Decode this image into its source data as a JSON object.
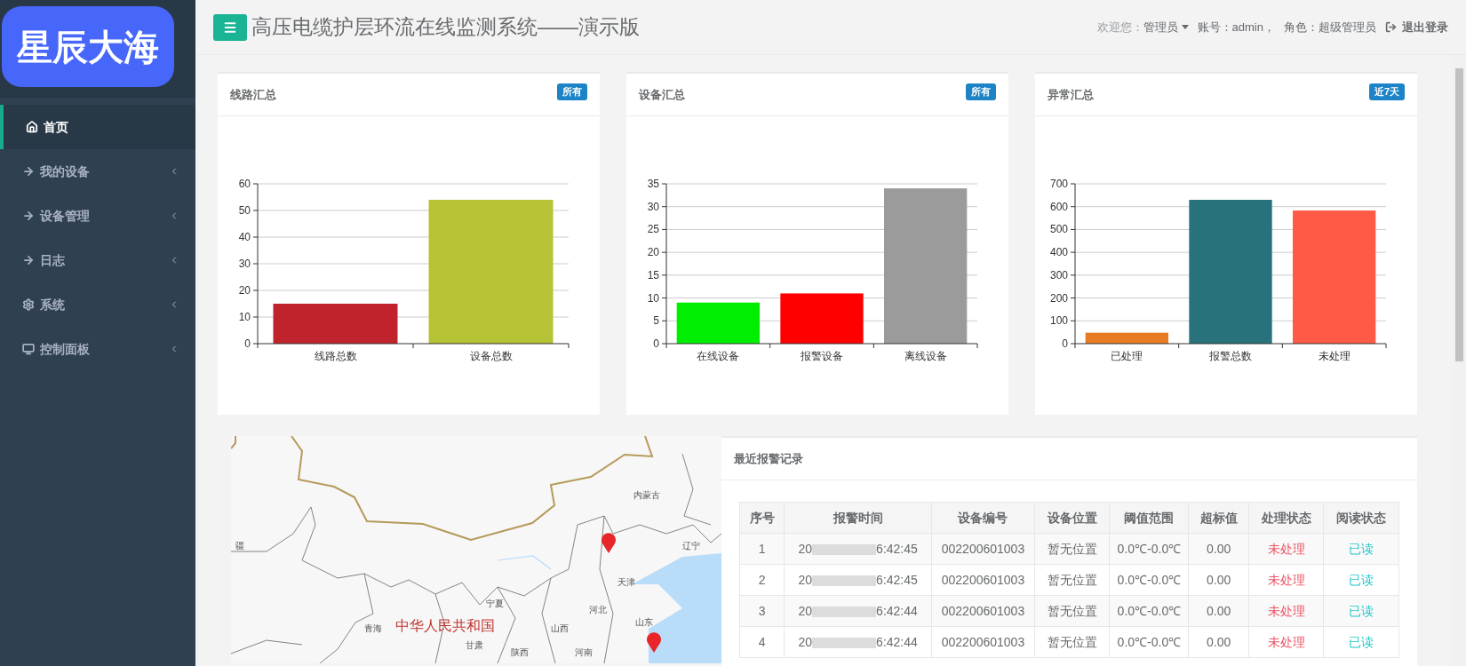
{
  "sidebar": {
    "logo": "星辰大海",
    "items": [
      {
        "label": "首页",
        "kind": "home",
        "selected": true,
        "has_submenu": false
      },
      {
        "label": "我的设备",
        "kind": "link",
        "selected": false,
        "has_submenu": true
      },
      {
        "label": "设备管理",
        "kind": "link",
        "selected": false,
        "has_submenu": true
      },
      {
        "label": "日志",
        "kind": "link",
        "selected": false,
        "has_submenu": true
      },
      {
        "label": "系统",
        "kind": "settings",
        "selected": false,
        "has_submenu": true
      },
      {
        "label": "控制面板",
        "kind": "display",
        "selected": false,
        "has_submenu": true
      }
    ]
  },
  "header": {
    "title": "高压电缆护层环流在线监测系统——演示版",
    "welcome": "欢迎您：",
    "user": "管理员",
    "account": "账号：admin，",
    "role": "角色：超级管理员",
    "logout": "退出登录"
  },
  "cards": [
    {
      "title": "线路汇总",
      "badge": "所有",
      "chart_data": {
        "type": "bar",
        "categories": [
          "线路总数",
          "设备总数"
        ],
        "colors": [
          "#c0232c",
          "#b5c334"
        ],
        "values": [
          15,
          54
        ],
        "grid": true,
        "ylim": [
          0,
          60
        ],
        "yticks": [
          0,
          10,
          20,
          30,
          40,
          50,
          60
        ]
      }
    },
    {
      "title": "设备汇总",
      "badge": "所有",
      "chart_data": {
        "type": "bar",
        "categories": [
          "在线设备",
          "报警设备",
          "离线设备"
        ],
        "colors": [
          "#00ee00",
          "#ff0000",
          "#9b9b9b"
        ],
        "values": [
          9,
          11,
          34
        ],
        "grid": true,
        "ylim": [
          0,
          35
        ],
        "yticks": [
          0,
          5,
          10,
          15,
          20,
          25,
          30,
          35
        ]
      }
    },
    {
      "title": "异常汇总",
      "badge": "近7天",
      "chart_data": {
        "type": "bar",
        "categories": [
          "已处理",
          "报警总数",
          "未处理"
        ],
        "colors": [
          "#e87c25",
          "#27727b",
          "#ff5a45"
        ],
        "values": [
          48,
          630,
          583
        ],
        "grid": true,
        "ylim": [
          0,
          700
        ],
        "yticks": [
          0,
          100,
          200,
          300,
          400,
          500,
          600,
          700
        ]
      }
    }
  ],
  "map": {
    "country": "中华人民共和国",
    "regions": [
      "内蒙古",
      "疆",
      "辽宁",
      "天津",
      "宁夏",
      "河北",
      "青海",
      "山西",
      "山东",
      "甘肃",
      "陕西",
      "河南"
    ]
  },
  "alarms": {
    "title": "最近报警记录",
    "columns": [
      "序号",
      "报警时间",
      "设备编号",
      "设备位置",
      "阈值范围",
      "超标值",
      "处理状态",
      "阅读状态"
    ],
    "rows": [
      {
        "index": "1",
        "time_head": "20",
        "time_tail": "6:42:45",
        "device": "002200601003",
        "location": "暂无位置",
        "range": "0.0℃-0.0℃",
        "excess": "0.00",
        "status": "未处理",
        "read": "已读"
      },
      {
        "index": "2",
        "time_head": "20",
        "time_tail": "6:42:45",
        "device": "002200601003",
        "location": "暂无位置",
        "range": "0.0℃-0.0℃",
        "excess": "0.00",
        "status": "未处理",
        "read": "已读"
      },
      {
        "index": "3",
        "time_head": "20",
        "time_tail": "6:42:44",
        "device": "002200601003",
        "location": "暂无位置",
        "range": "0.0℃-0.0℃",
        "excess": "0.00",
        "status": "未处理",
        "read": "已读"
      },
      {
        "index": "4",
        "time_head": "20",
        "time_tail": "6:42:44",
        "device": "002200601003",
        "location": "暂无位置",
        "range": "0.0℃-0.0℃",
        "excess": "0.00",
        "status": "未处理",
        "read": "已读"
      }
    ]
  }
}
